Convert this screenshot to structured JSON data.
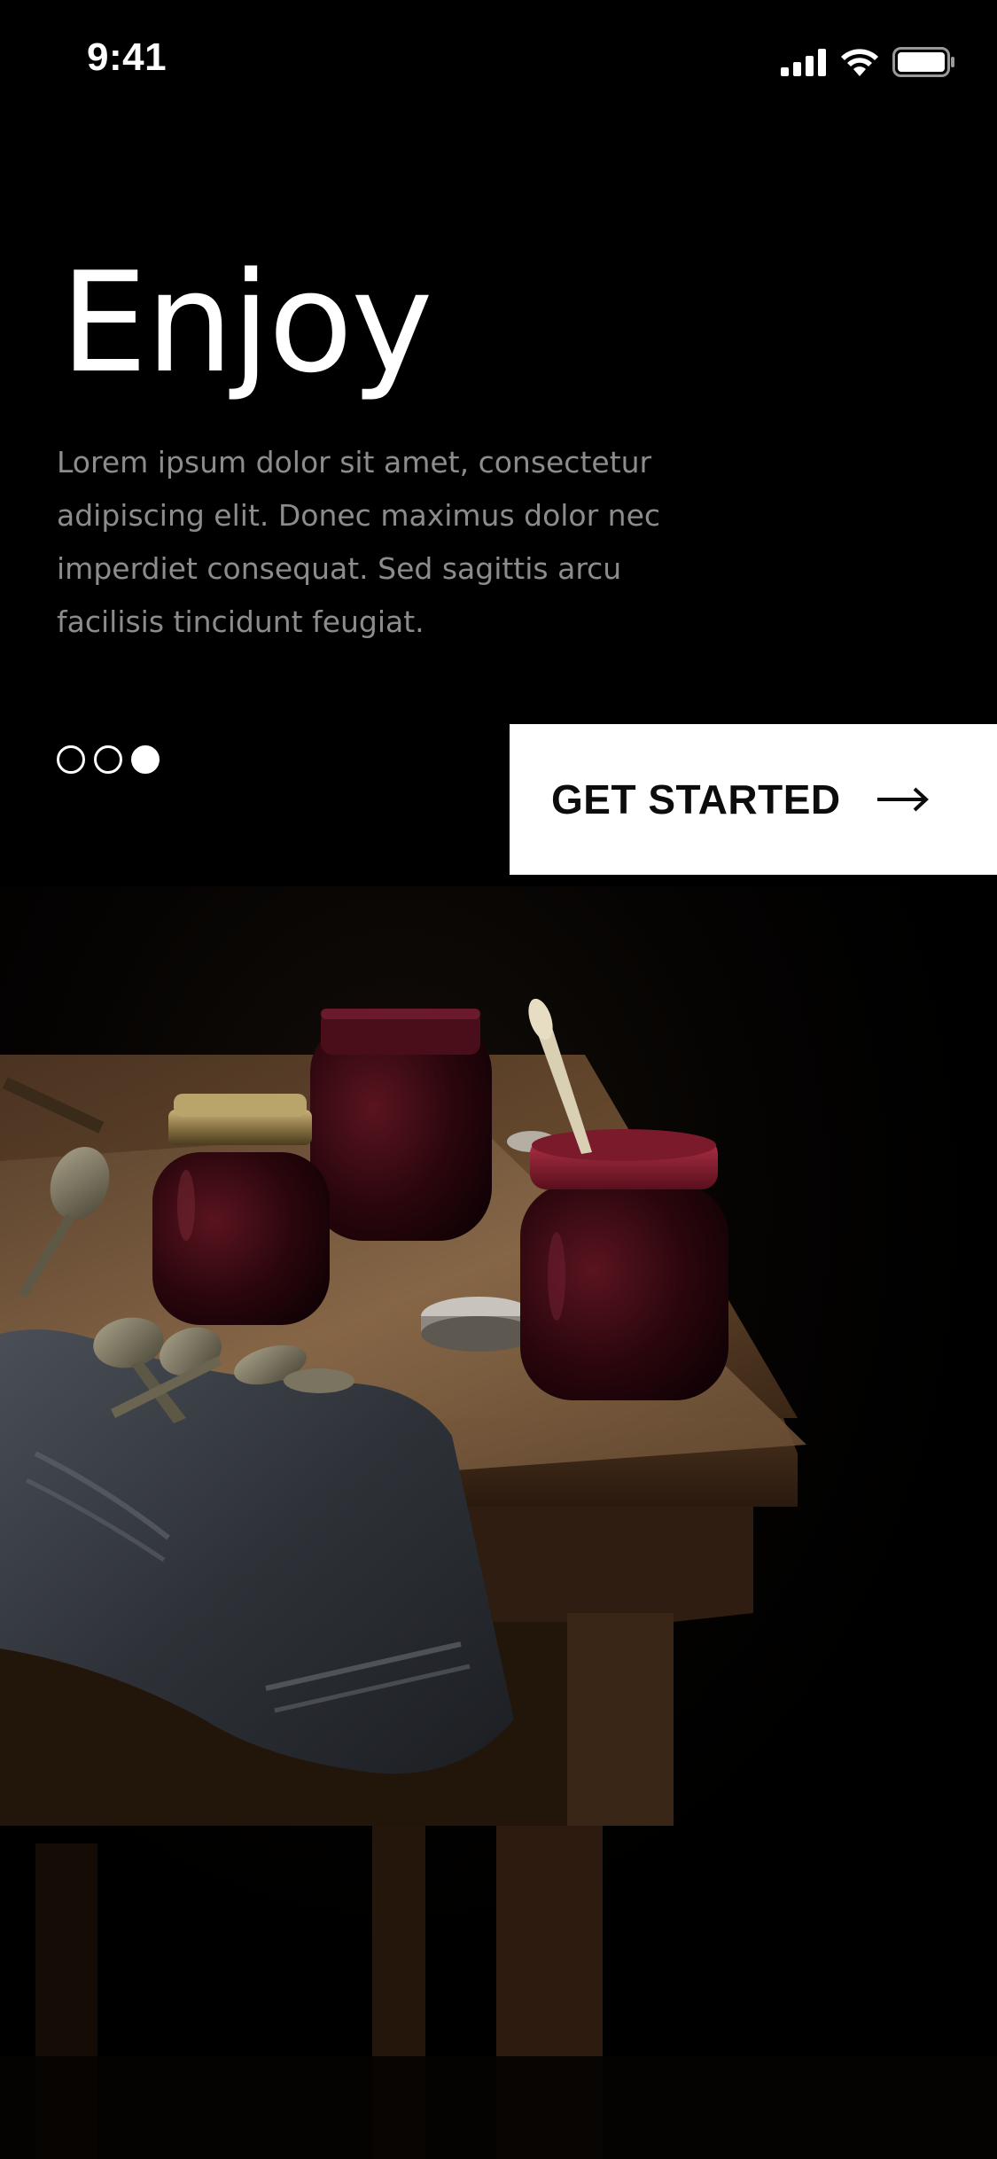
{
  "status_bar": {
    "time": "9:41",
    "icons": [
      "cellular-signal-icon",
      "wifi-icon",
      "battery-icon"
    ]
  },
  "hero": {
    "title": "Enjoy",
    "body_lines": [
      "Lorem ipsum dolor sit amet, consectetur",
      "adipiscing elit. Donec maximus dolor nec",
      "imperdiet consequat. Sed sagittis arcu",
      "facilisis tincidunt feugiat."
    ]
  },
  "pagination": {
    "total": 3,
    "active_index": 2
  },
  "cta": {
    "label": "GET STARTED",
    "icon": "arrow-right-icon"
  },
  "colors": {
    "background": "#000000",
    "title": "#ffffff",
    "body_text": "#8c8c8c",
    "cta_background": "#ffffff",
    "cta_text": "#0c0c0c",
    "jam": "#3a0b14",
    "wood": "#5a3c22"
  }
}
